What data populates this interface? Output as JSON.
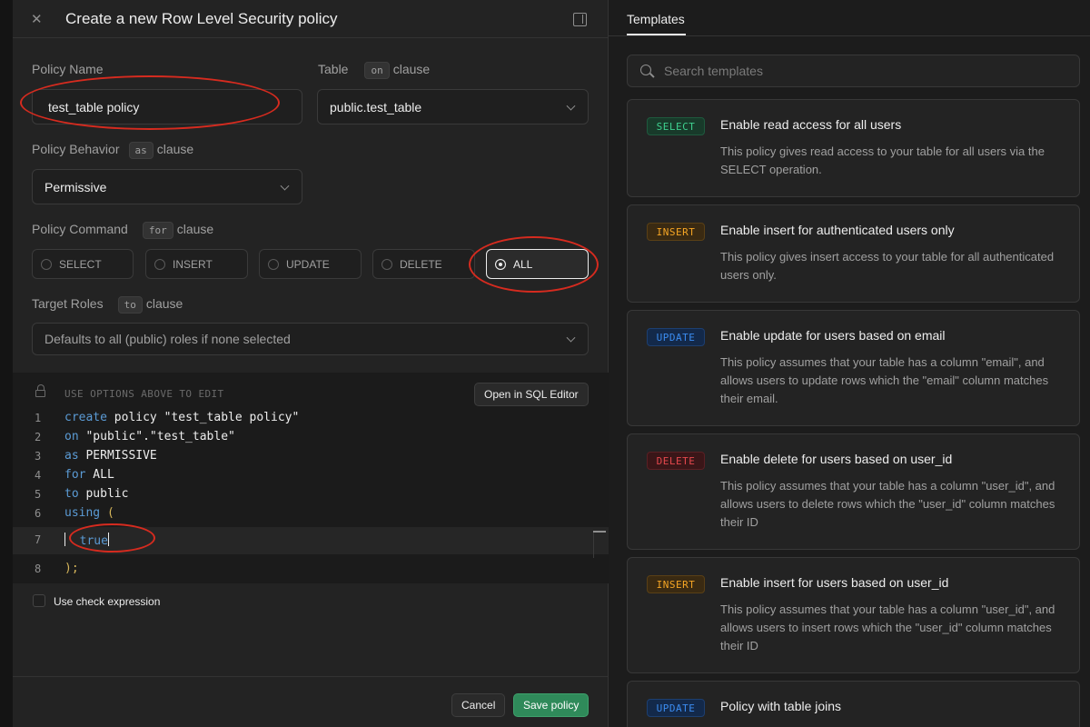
{
  "header": {
    "title": "Create a new Row Level Security policy"
  },
  "form": {
    "policy_name": {
      "label": "Policy Name",
      "value": "test_table policy"
    },
    "table": {
      "label": "Table",
      "chip": "on",
      "suffix": "clause",
      "value": "public.test_table"
    },
    "behavior": {
      "label": "Policy Behavior",
      "chip": "as",
      "suffix": "clause",
      "value": "Permissive"
    },
    "command": {
      "label": "Policy Command",
      "chip": "for",
      "suffix": "clause",
      "options": [
        "SELECT",
        "INSERT",
        "UPDATE",
        "DELETE",
        "ALL"
      ],
      "selected": "ALL"
    },
    "roles": {
      "label": "Target Roles",
      "chip": "to",
      "suffix": "clause",
      "placeholder": "Defaults to all (public) roles if none selected"
    }
  },
  "editor": {
    "hint": "USE OPTIONS ABOVE TO EDIT",
    "open_sql": "Open in SQL Editor",
    "line_numbers": [
      "1",
      "2",
      "3",
      "4",
      "5",
      "6",
      "7",
      "8"
    ],
    "code": {
      "l1_kw": "create",
      "l1_kw2": "policy",
      "l1_rest": " \"test_table policy\"",
      "l2_kw": "on",
      "l2_rest": " \"public\".\"test_table\"",
      "l3_kw": "as",
      "l3_rest": " PERMISSIVE",
      "l4_kw": "for",
      "l4_rest": " ALL",
      "l5_kw": "to",
      "l5_rest": " public",
      "l6_kw": "using",
      "l6_paren": "(",
      "l7_value": "true",
      "l8_close": ");"
    }
  },
  "check_expression_label": "Use check expression",
  "footer": {
    "cancel": "Cancel",
    "save": "Save policy"
  },
  "templates": {
    "tab": "Templates",
    "search_placeholder": "Search templates",
    "cards": [
      {
        "badge": "SELECT",
        "title": "Enable read access for all users",
        "desc": "This policy gives read access to your table for all users via the SELECT operation."
      },
      {
        "badge": "INSERT",
        "title": "Enable insert for authenticated users only",
        "desc": "This policy gives insert access to your table for all authenticated users only."
      },
      {
        "badge": "UPDATE",
        "title": "Enable update for users based on email",
        "desc": "This policy assumes that your table has a column \"email\", and allows users to update rows which the \"email\" column matches their email."
      },
      {
        "badge": "DELETE",
        "title": "Enable delete for users based on user_id",
        "desc": "This policy assumes that your table has a column \"user_id\", and allows users to delete rows which the \"user_id\" column matches their ID"
      },
      {
        "badge": "INSERT",
        "title": "Enable insert for users based on user_id",
        "desc": "This policy assumes that your table has a column \"user_id\", and allows users to insert rows which the \"user_id\" column matches their ID"
      },
      {
        "badge": "UPDATE",
        "title": "Policy with table joins",
        "desc": ""
      }
    ]
  },
  "colors": {
    "accent_green": "#2f8a5a",
    "badge_select": "#3ecf8e",
    "badge_insert": "#f5a524",
    "badge_update": "#3b8cf0",
    "badge_delete": "#e5484d",
    "annotation_red": "#d62b1f"
  }
}
